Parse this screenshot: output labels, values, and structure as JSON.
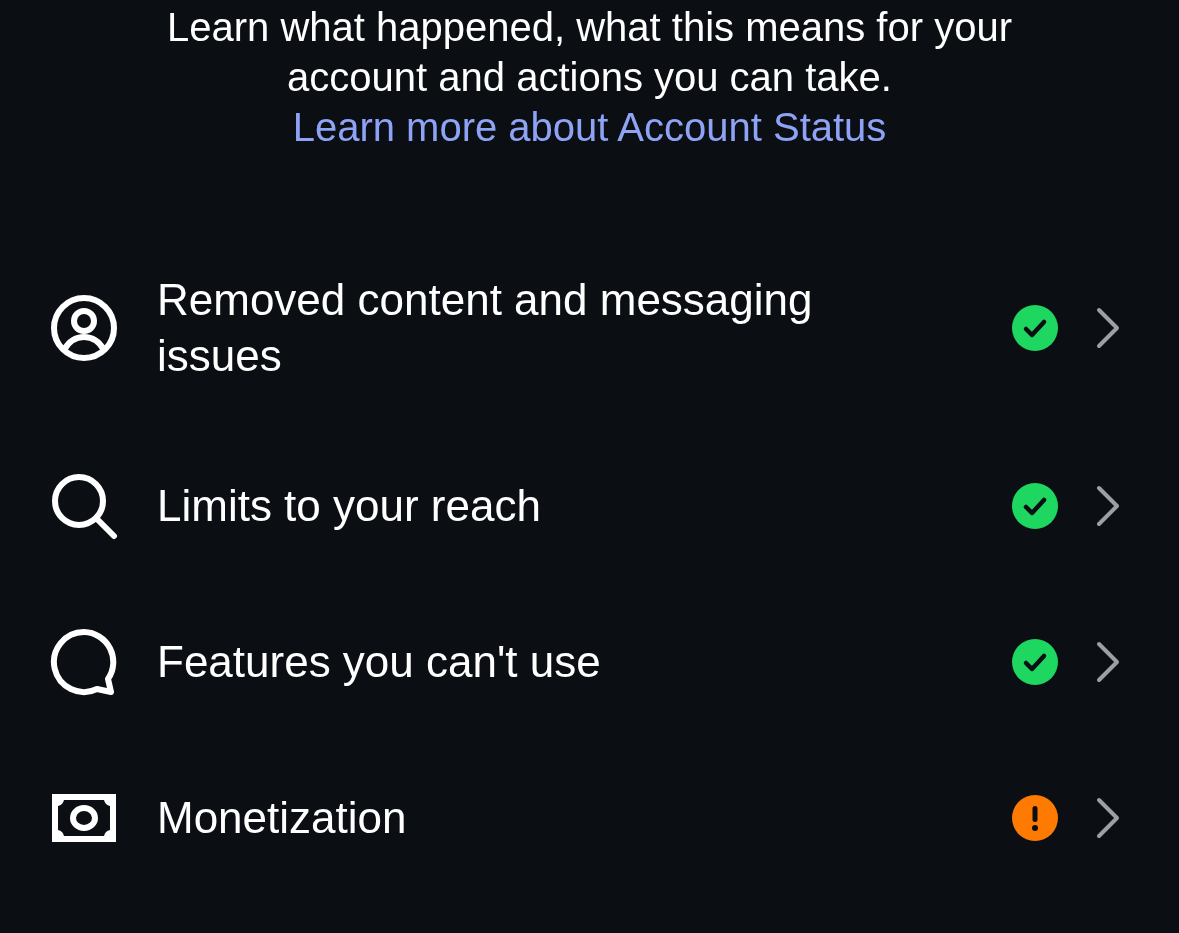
{
  "intro": {
    "text": "Learn what happened, what this means for your account and actions you can take.",
    "link": "Learn more about Account Status"
  },
  "items": [
    {
      "label": "Removed content and messaging issues",
      "alert": false
    },
    {
      "label": "Limits to your reach",
      "alert": false
    },
    {
      "label": "Features you can't use",
      "alert": false
    },
    {
      "label": "Monetization",
      "alert": true
    }
  ]
}
